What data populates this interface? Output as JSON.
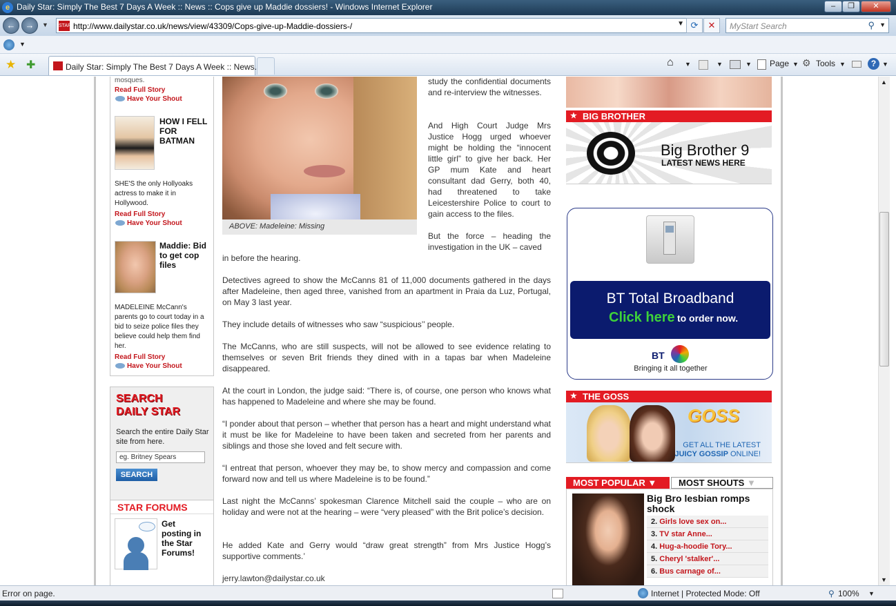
{
  "window": {
    "title": "Daily Star: Simply The Best 7 Days A Week :: News :: Cops give up Maddie dossiers! - Windows Internet Explorer"
  },
  "address_bar": {
    "url": "http://www.dailystar.co.uk/news/view/43309/Cops-give-up-Maddie-dossiers-/",
    "search_placeholder": "MyStart Search"
  },
  "tab": {
    "label": "Daily Star: Simply The Best 7 Days A Week :: News..."
  },
  "toolbar": {
    "page_label": "Page",
    "tools_label": "Tools"
  },
  "left_column": {
    "top_fragment": "mosques.",
    "read_full_story": "Read Full Story",
    "have_your_shout": "Have Your Shout",
    "stories": [
      {
        "headline": "HOW I FELL FOR BATMAN",
        "summary": "SHE'S the only Hollyoaks actress to make it in Hollywood."
      },
      {
        "headline": "Maddie: Bid to get cop files",
        "summary": "MADELEINE McCann's parents go to court today in a bid to seize police files they believe could help them find her."
      }
    ],
    "search": {
      "heading_line1": "SEARCH",
      "heading_line2": "DAILY STAR",
      "description": "Search the entire Daily Star site from here.",
      "input_value": "eg. Britney Spears",
      "button_label": "SEARCH"
    },
    "forums": {
      "heading": "STAR FORUMS",
      "text": "Get posting in the Star Forums!"
    }
  },
  "article": {
    "caption": "ABOVE: Madeleine: Missing",
    "p1": "study the confidential documents and re-interview the witnesses.",
    "p2": "And High Court Judge Mrs Justice Hogg urged whoever might be holding the “innocent little girl” to give her back. Her GP mum Kate and heart consultant dad Gerry, both 40, had threatened to take Leicestershire Police to court to gain access to the files.",
    "p3a": "But the force – heading the investigation in the UK – caved",
    "p3b": "in before the hearing.",
    "p4": "Detectives agreed to show the McCanns 81 of 11,000 documents gathered in the days after Madeleine, then aged three, vanished from an apartment in Praia da Luz, Portugal, on May 3 last year.",
    "p5": "They include details of witnesses who saw “suspicious’’ people.",
    "p6": "The McCanns, who are still suspects, will not be allowed to see evidence relating to themselves or seven Brit friends they dined with in a tapas bar when Madeleine disappeared.",
    "p7": "At the court in London, the judge said: “There is, of course, one person who knows what has happened to Madeleine and where she may be found.",
    "p8": "“I ponder about that person – whether that person has a heart and might understand what it must be like for Madeleine to have been taken and secreted from her parents and siblings and those she loved and felt secure with.",
    "p9": "“I entreat that person, whoever they may be, to show mercy and compassion and come forward now and tell us where Madeleine is to be found.”",
    "p10": "Last night the McCanns’ spokesman Clarence Mitchell said the couple – who are on holiday and were not at the hearing – were “very pleased” with the Brit police’s decision.",
    "p11": "He added Kate and Gerry would “draw great strength” from Mrs Justice Hogg’s supportive comments.’",
    "email": "jerry.lawton@dailystar.co.uk"
  },
  "right_column": {
    "big_brother": {
      "heading": "BIG BROTHER",
      "title": "Big Brother 9",
      "subtitle": "LATEST NEWS HERE"
    },
    "bt_ad": {
      "headline": "BT Total Broadband",
      "click": "Click here",
      "order": "to order now.",
      "brand": "BT",
      "tagline": "Bringing it all together"
    },
    "goss": {
      "heading": "THE GOSS",
      "logo": "GOSS",
      "line1": "GET ALL THE LATEST",
      "line2a": "JUICY GOSSIP",
      "line2b": "ONLINE!"
    },
    "popular": {
      "tab_popular": "MOST POPULAR",
      "tab_shouts": "MOST SHOUTS",
      "lead_headline": "Big Bro lesbian romps shock",
      "items": [
        {
          "num": "2.",
          "title": "Girls love sex on..."
        },
        {
          "num": "3.",
          "title": "TV star Anne..."
        },
        {
          "num": "4.",
          "title": "Hug-a-hoodie Tory..."
        },
        {
          "num": "5.",
          "title": "Cheryl 'stalker'..."
        },
        {
          "num": "6.",
          "title": "Bus carnage of..."
        }
      ]
    }
  },
  "status_bar": {
    "status": "Error on page.",
    "zone": "Internet | Protected Mode: Off",
    "zoom": "100%"
  },
  "colors": {
    "brand_red": "#e31b23",
    "bt_navy": "#0b1b6e",
    "bt_green": "#3ed13a",
    "ie_chrome": "#c6d6e8"
  }
}
